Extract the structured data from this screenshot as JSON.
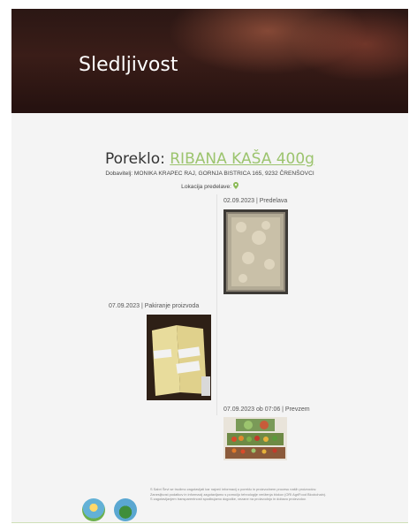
{
  "hero": {
    "title": "Sledljivost"
  },
  "origin": {
    "prefix": "Poreklo: ",
    "product": "RIBANA KAŠA 400g"
  },
  "supplier": "Dobavitelj: MONIKA KRAPEC RAJ, GORNJA BISTRICA 165, 9232 ČRENŠOVCI",
  "location_label": "Lokacija predelave:",
  "timeline": [
    {
      "label": "02.09.2023 | Predelava"
    },
    {
      "label": "07.09.2023 | Pakiranje proizvoda"
    },
    {
      "label": "07.09.2023 ob 07:06 | Prevzem"
    }
  ],
  "footer": {
    "lines": [
      "S Sabri Ševi se trudimo zagotavljati kar največ informacij o poreklu in proizvodnem procesu naših proizvodov.",
      "Zanesljivost podatkov in informacij zagotavljamo s pomočjo tehnologije veriženja blokov (ORI AgriFood Blockchain).",
      "S zagotavljanjem transparentnosti spodbujamo dogodke, vezane na proizvodnjo in dobavo proizvodov."
    ]
  },
  "colors": {
    "accent": "#9cc46e",
    "hero_bg": "#2f1916",
    "page_bg": "#f4f4f4"
  }
}
